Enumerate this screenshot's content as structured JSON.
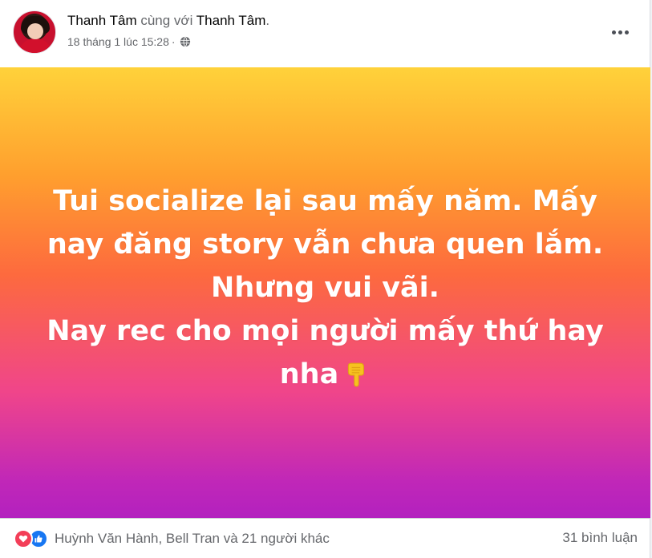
{
  "post": {
    "author": "Thanh Tâm",
    "with_text": " cùng với ",
    "tagged": "Thanh Tâm",
    "period": ".",
    "timestamp": "18 tháng 1 lúc 15:28",
    "privacy_icon": "globe-icon",
    "more_icon": "more-options-icon",
    "background_colors": [
      "#ffd23a",
      "#ff9f2e",
      "#fd6a3e",
      "#f0458a",
      "#b321bf"
    ],
    "text_lines": [
      "Tui socialize lại sau mấy năm. Mấy",
      "nay đăng story vẫn chưa quen lắm.",
      "Nhưng vui vãi.",
      "Nay rec cho mọi người mấy thứ hay",
      "nha"
    ],
    "emoji": "backhand-index-pointing-down"
  },
  "footer": {
    "reaction_icons": [
      "love-icon",
      "like-icon"
    ],
    "reaction_names": "Huỳnh Văn Hành, Bell Tran và 21 người khác",
    "comment_count": "31 bình luận"
  }
}
